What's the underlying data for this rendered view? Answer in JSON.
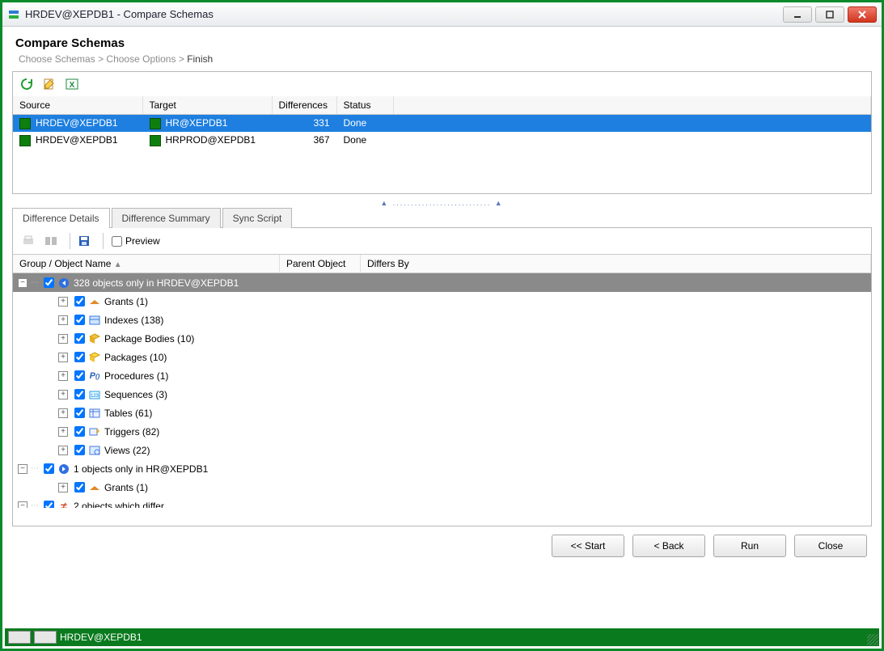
{
  "window": {
    "title": "HRDEV@XEPDB1 - Compare Schemas"
  },
  "page": {
    "heading": "Compare Schemas",
    "steps": {
      "step1": "Choose Schemas",
      "step2": "Choose Options",
      "step3": "Finish",
      "sep": ">"
    }
  },
  "toolbar": {
    "refresh": "refresh",
    "edit": "edit",
    "excel": "excel"
  },
  "compareTable": {
    "cols": {
      "source": "Source",
      "target": "Target",
      "diff": "Differences",
      "status": "Status"
    },
    "rows": [
      {
        "source": "HRDEV@XEPDB1",
        "target": "HR@XEPDB1",
        "diff": "331",
        "status": "Done",
        "selected": true
      },
      {
        "source": "HRDEV@XEPDB1",
        "target": "HRPROD@XEPDB1",
        "diff": "367",
        "status": "Done",
        "selected": false
      }
    ]
  },
  "tabs": {
    "details": "Difference Details",
    "summary": "Difference Summary",
    "sync": "Sync Script"
  },
  "detailsToolbar": {
    "preview": "Preview"
  },
  "tree": {
    "cols": {
      "name": "Group / Object Name",
      "parent": "Parent Object",
      "differs": "Differs By"
    },
    "sort": "▲",
    "groupA": "328 objects only in HRDEV@XEPDB1",
    "grants": "Grants (1)",
    "indexes": "Indexes (138)",
    "pkgbodies": "Package Bodies (10)",
    "packages": "Packages (10)",
    "procedures": "Procedures (1)",
    "sequences": "Sequences (3)",
    "tables": "Tables (61)",
    "triggers": "Triggers (82)",
    "views": "Views (22)",
    "groupB": "1 objects only in HR@XEPDB1",
    "grantsB": "Grants (1)",
    "groupC": "2 objects which differ"
  },
  "buttons": {
    "start": "<< Start",
    "back": "< Back",
    "run": "Run",
    "close": "Close"
  },
  "statusbar": {
    "connection": "HRDEV@XEPDB1"
  }
}
